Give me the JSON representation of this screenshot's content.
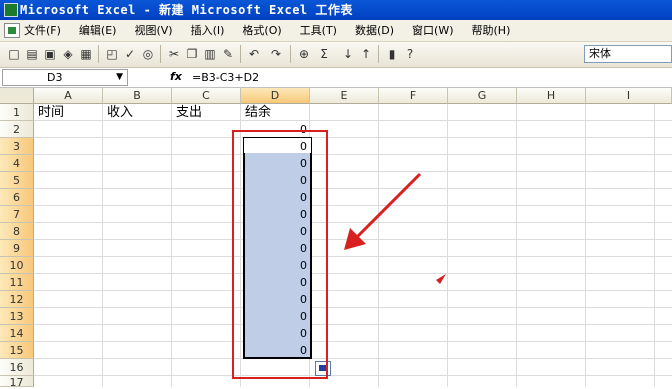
{
  "window": {
    "title": "Microsoft Excel - 新建 Microsoft Excel 工作表"
  },
  "menu": [
    "文件(F)",
    "编辑(E)",
    "视图(V)",
    "插入(I)",
    "格式(O)",
    "工具(T)",
    "数据(D)",
    "窗口(W)",
    "帮助(H)"
  ],
  "toolbar": {
    "icons": [
      "new-icon",
      "open-icon",
      "save-icon",
      "permission-icon",
      "print-icon",
      "print-preview-icon",
      "spelling-icon",
      "research-icon",
      "cut-icon",
      "copy-icon",
      "paste-icon",
      "format-painter-icon",
      "undo-icon",
      "redo-icon",
      "hyperlink-icon",
      "autosum-icon",
      "sort-ascending-icon",
      "sort-descending-icon",
      "chart-wizard-icon",
      "help-icon"
    ],
    "font_name": "宋体"
  },
  "formula_bar": {
    "cell_ref": "D3",
    "fx": "fx",
    "formula": "=B3-C3+D2"
  },
  "columns": [
    "A",
    "B",
    "C",
    "D",
    "E",
    "F",
    "G",
    "H",
    "I"
  ],
  "rows": [
    "1",
    "2",
    "3",
    "4",
    "5",
    "6",
    "7",
    "8",
    "9",
    "10",
    "11",
    "12",
    "13",
    "14",
    "15",
    "16",
    "17"
  ],
  "headers": {
    "A1": "时间",
    "B1": "收入",
    "C1": "支出",
    "D1": "结余"
  },
  "column_d_values": [
    "0",
    "0",
    "0",
    "0",
    "0",
    "0",
    "0",
    "0",
    "0",
    "0",
    "0",
    "0",
    "0",
    "0"
  ],
  "annotation_color": "#d82020"
}
